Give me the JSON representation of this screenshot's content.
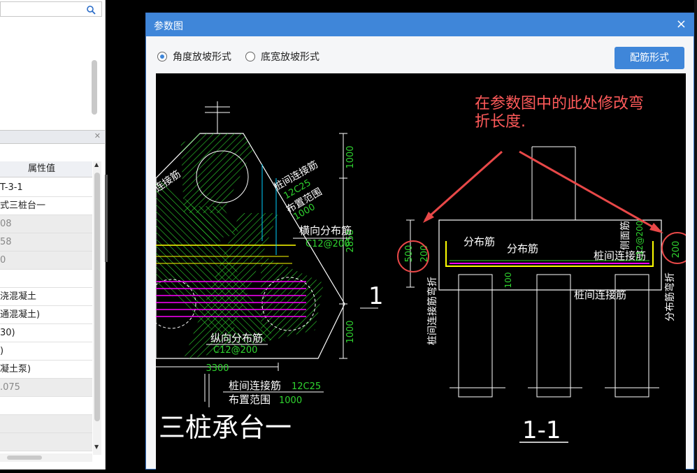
{
  "left_panel": {
    "search_placeholder": "",
    "properties_header": "属性值",
    "rows": [
      {
        "value": "T-3-1",
        "gray": false
      },
      {
        "value": "式三桩台一",
        "gray": false
      },
      {
        "value": "08",
        "gray": true
      },
      {
        "value": "58",
        "gray": true
      },
      {
        "value": "0",
        "gray": true
      },
      {
        "value": "",
        "gray": false
      },
      {
        "value": "浇混凝土",
        "gray": false
      },
      {
        "value": "通混凝土)",
        "gray": false
      },
      {
        "value": "30)",
        "gray": false
      },
      {
        "value": ")",
        "gray": false
      },
      {
        "value": "凝土泵)",
        "gray": false
      },
      {
        "value": ".075",
        "gray": true
      },
      {
        "value": "",
        "gray": false
      },
      {
        "value": "",
        "gray": true
      },
      {
        "value": "",
        "gray": true
      }
    ]
  },
  "dialog": {
    "title": "参数图",
    "close": "×",
    "radio_angle": "角度放坡形式",
    "radio_width": "底宽放坡形式",
    "rebar_button": "配筋形式"
  },
  "drawing": {
    "annotation_line1": "在参数图中的此处修改弯",
    "annotation_line2": "折长度.",
    "plan": {
      "label_pile_rebar_diag": "桩间连接筋",
      "label_12c25_diag": "12C25",
      "label_range_diag": "布置范围",
      "label_1000_diag": "1000",
      "label_trans_dist": "横向分布筋",
      "label_c12_200_a": "C12@200",
      "label_long_dist": "纵向分布筋",
      "label_c12_200_b": "C12@200",
      "label_left_rebar": "连接筋",
      "dim_3300": "3300",
      "dim_1000_top": "1000",
      "dim_2858": "2858",
      "dim_1000_bot": "1000",
      "label_pile_rebar_bottom": "桩间连接筋",
      "label_12c25_bottom": "12C25",
      "label_range_bottom": "布置范围",
      "label_1000_bottom": "1000",
      "section_mark": "1",
      "title": "三桩承台一"
    },
    "section": {
      "dim_500": "500",
      "dim_200_left": "200",
      "dim_200_right": "200",
      "dim_100": "100",
      "label_dist1": "分布筋",
      "label_dist2": "分布筋",
      "label_pile_conn": "桩间连接筋",
      "label_pile_conn_bottom": "桩间连接筋",
      "label_side_rebar": "侧面筋",
      "label_c12_200_side": "C12@200",
      "label_left_vertical": "桩间连接筋弯折",
      "label_right_vertical": "分布筋弯折",
      "title": "1-1"
    }
  }
}
